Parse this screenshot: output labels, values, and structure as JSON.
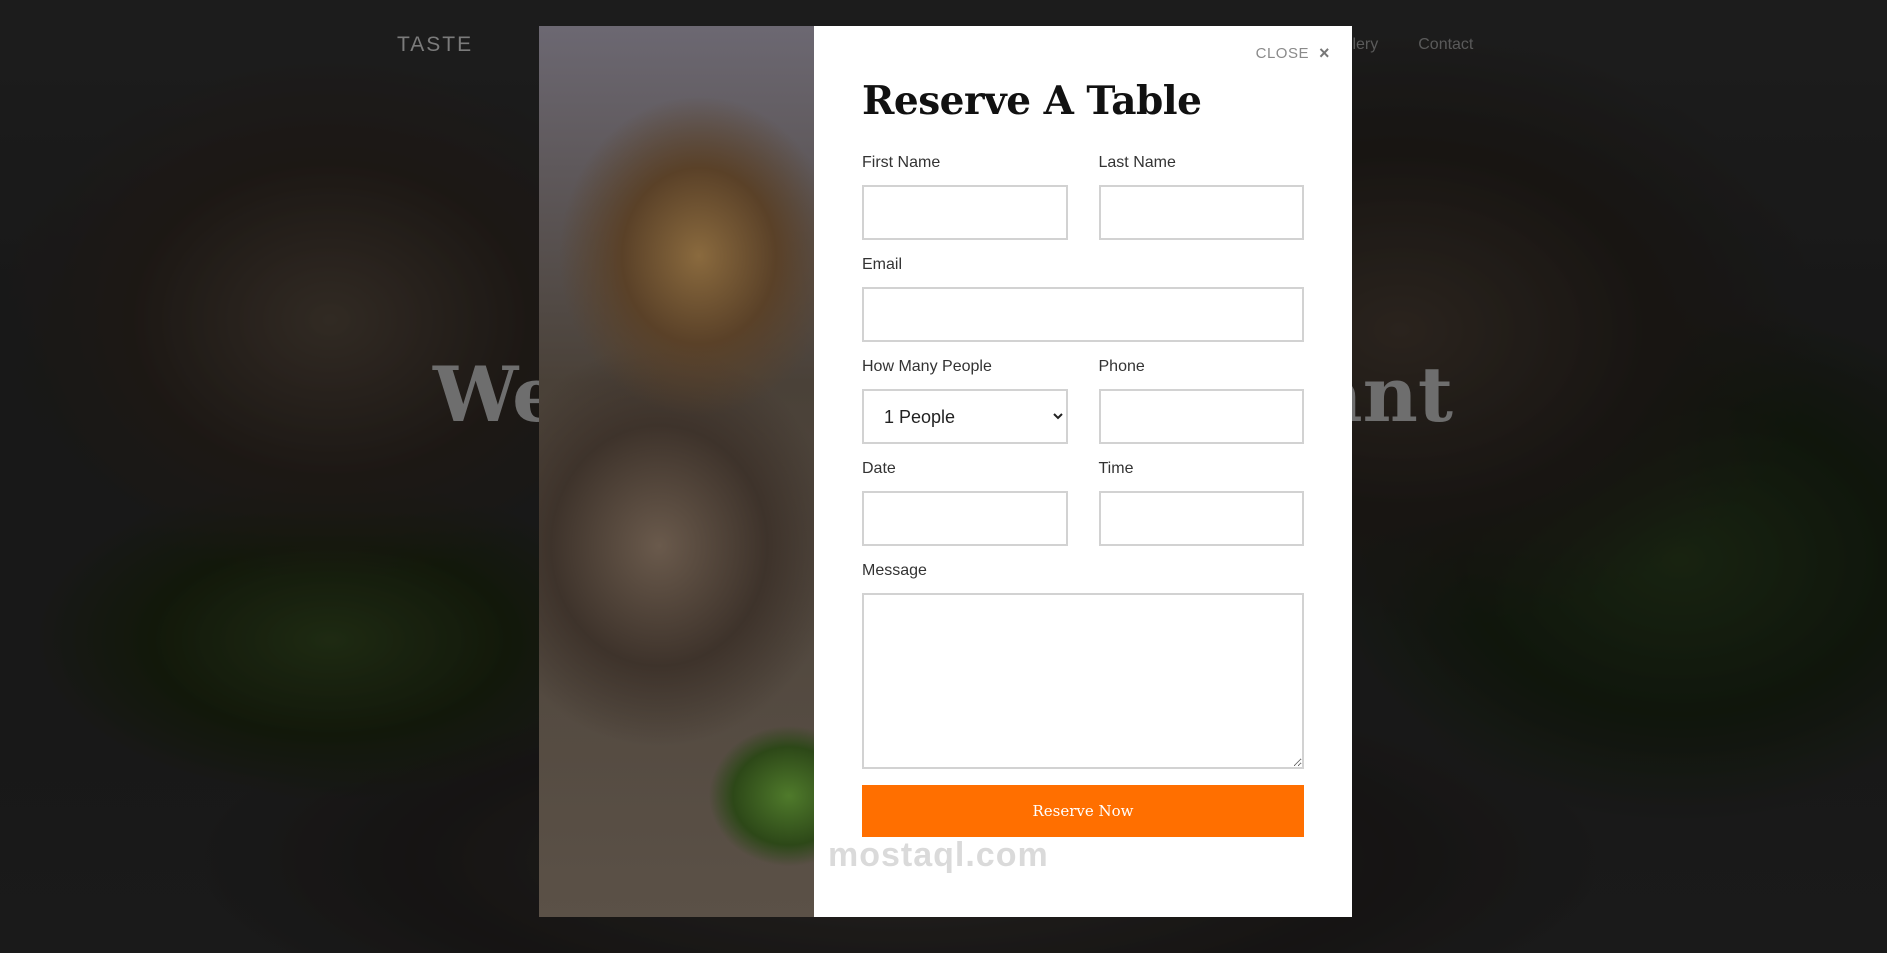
{
  "navbar": {
    "brand": "TASTE",
    "links": [
      "allery",
      "Contact"
    ]
  },
  "hero": {
    "title_left": "We",
    "title_right": "ant"
  },
  "modal": {
    "close_label": "CLOSE",
    "close_icon": "×",
    "title": "Reserve A Table",
    "fields": {
      "first_name": {
        "label": "First Name",
        "value": ""
      },
      "last_name": {
        "label": "Last Name",
        "value": ""
      },
      "email": {
        "label": "Email",
        "value": ""
      },
      "people": {
        "label": "How Many People",
        "selected": "1 People"
      },
      "phone": {
        "label": "Phone",
        "value": ""
      },
      "date": {
        "label": "Date",
        "value": ""
      },
      "time": {
        "label": "Time",
        "value": ""
      },
      "message": {
        "label": "Message",
        "value": ""
      }
    },
    "submit_label": "Reserve Now"
  },
  "watermark": "mostaql.com",
  "colors": {
    "accent": "#ff6f00",
    "modal_bg": "#ffffff",
    "input_border": "#d2d2d2"
  }
}
